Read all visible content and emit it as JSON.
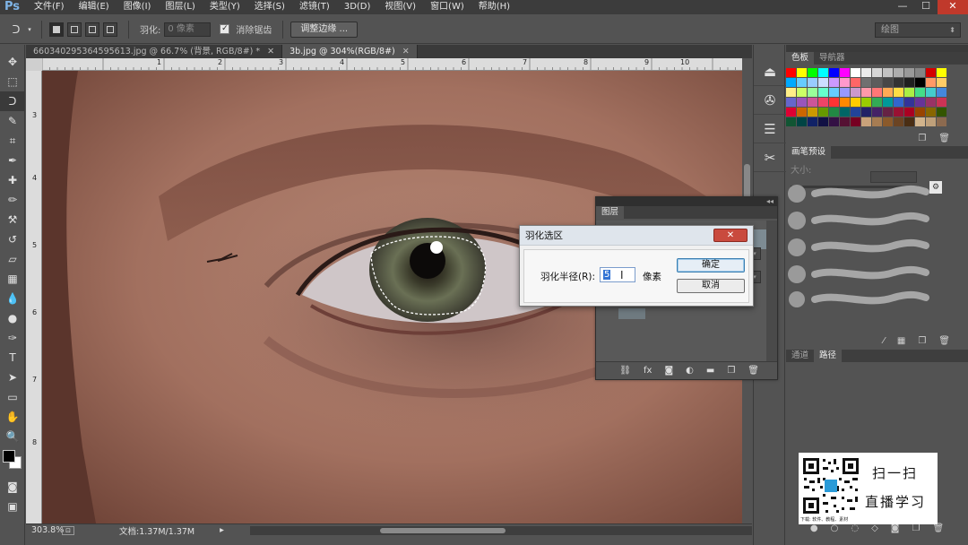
{
  "app": {
    "logo": "Ps",
    "menu": [
      "文件(F)",
      "编辑(E)",
      "图像(I)",
      "图层(L)",
      "类型(Y)",
      "选择(S)",
      "滤镜(T)",
      "3D(D)",
      "视图(V)",
      "窗口(W)",
      "帮助(H)"
    ],
    "window_controls": [
      "—",
      "☐",
      "✕"
    ]
  },
  "options_bar": {
    "feather_label": "羽化:",
    "feather_value": "0 像素",
    "antialias_label": "消除锯齿",
    "antialias_checked": "✓",
    "refine_edge_label": "调整边缘 ...",
    "workspace": "绘图"
  },
  "tabs": [
    {
      "label": "660340295364595613.jpg @ 66.7% (背景, RGB/8#) *",
      "close": "✕"
    },
    {
      "label": "3b.jpg @ 304%(RGB/8#)",
      "close": "✕"
    }
  ],
  "rulers": {
    "top": [
      "1",
      "2",
      "3",
      "4",
      "5",
      "6",
      "7",
      "8",
      "9",
      "10"
    ],
    "left": [
      "3",
      "4",
      "5",
      "6",
      "7",
      "8"
    ]
  },
  "status": {
    "zoom": "303.8%",
    "doc": "文档:1.37M/1.37M"
  },
  "tools": [
    "move-tool",
    "marquee-tool",
    "lasso-tool",
    "quick-select-tool",
    "crop-tool",
    "eyedropper-tool",
    "healing-tool",
    "brush-tool",
    "stamp-tool",
    "history-brush-tool",
    "eraser-tool",
    "gradient-tool",
    "blur-tool",
    "dodge-tool",
    "pen-tool",
    "type-tool",
    "path-select-tool",
    "shape-tool",
    "hand-tool",
    "zoom-tool"
  ],
  "tool_glyphs": [
    "✥",
    "⬚",
    "ᑐ",
    "✎",
    "⌗",
    "✒",
    "✚",
    "✏",
    "⚒",
    "↺",
    "▱",
    "▦",
    "💧",
    "●",
    "✑",
    "T",
    "➤",
    "▭",
    "✋",
    "🔍"
  ],
  "swatch_panel": {
    "tabs": [
      "色板",
      "导航器"
    ],
    "colors": [
      "#ff0000",
      "#ffff00",
      "#00ff00",
      "#00ffff",
      "#0000ff",
      "#ff00ff",
      "#ffffff",
      "#ebebeb",
      "#d6d6d6",
      "#c2c2c2",
      "#adadad",
      "#999999",
      "#858585",
      "#d40000",
      "#ffff00",
      "#00aaff",
      "#66ccff",
      "#99ccff",
      "#ccddff",
      "#cc99ff",
      "#ff99cc",
      "#ff6666",
      "#707070",
      "#5c5c5c",
      "#474747",
      "#333333",
      "#1f1f1f",
      "#000000",
      "#ff9966",
      "#ffcc66",
      "#ffee88",
      "#ccff66",
      "#99ff99",
      "#66ffcc",
      "#66ccff",
      "#9999ff",
      "#cc99cc",
      "#ff99aa",
      "#ff7777",
      "#ffaa55",
      "#ffdd44",
      "#aaee44",
      "#44dd88",
      "#44cccc",
      "#4488dd",
      "#6666cc",
      "#9955bb",
      "#cc5599",
      "#ee4466",
      "#ff3333",
      "#ff8800",
      "#ffcc00",
      "#99cc00",
      "#33aa55",
      "#009999",
      "#3366cc",
      "#333399",
      "#663399",
      "#993366",
      "#cc3355",
      "#dd0033",
      "#cc6600",
      "#cc9900",
      "#669900",
      "#228844",
      "#006666",
      "#224499",
      "#222266",
      "#442266",
      "#662244",
      "#991133",
      "#aa0022",
      "#994400",
      "#886600",
      "#335500",
      "#115533",
      "#004444",
      "#112266",
      "#111144",
      "#331144",
      "#551133",
      "#770022",
      "#c9a27a",
      "#a67c52",
      "#8b5a2b",
      "#6b4423",
      "#4a2e14",
      "#d2b48c",
      "#bfa07a",
      "#8c6a4f"
    ]
  },
  "brush_panel": {
    "tabs": [
      "画笔预设"
    ],
    "size_label": "大小:"
  },
  "paths_panel": {
    "tabs": [
      "通道",
      "路径"
    ]
  },
  "layers_panel": {
    "tab": "图层",
    "collapse": "◂◂"
  },
  "feather_dialog": {
    "title": "羽化选区",
    "radius_label": "羽化半径(R):",
    "radius_value": "5",
    "unit": "像素",
    "ok": "确定",
    "cancel": "取消",
    "close": "✕"
  },
  "qr_overlay": {
    "line1": "扫一扫",
    "line2": "直播学习",
    "caption": "下载: 软件、教程、素材"
  }
}
